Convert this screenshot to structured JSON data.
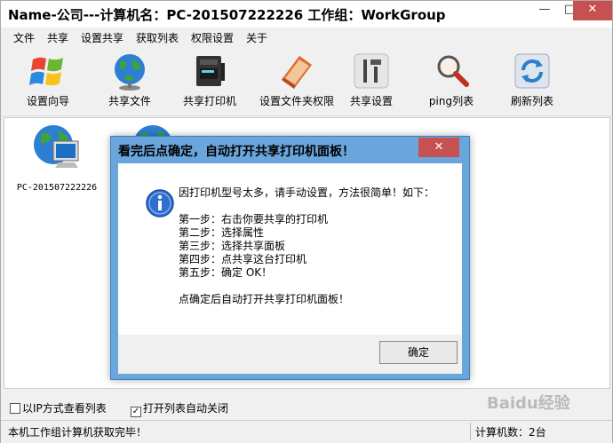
{
  "window": {
    "title": "Name-公司---计算机名：PC-201507222226  工作组：WorkGroup",
    "min_glyph": "—",
    "max_glyph": "□",
    "close_glyph": "✕"
  },
  "menu": {
    "items": [
      "文件",
      "共享",
      "设置共享",
      "获取列表",
      "权限设置",
      "关于"
    ]
  },
  "toolbar": {
    "items": [
      {
        "label": "设置向导",
        "icon": "windows-flag-icon"
      },
      {
        "label": "共享文件",
        "icon": "globe-icon"
      },
      {
        "label": "共享打印机",
        "icon": "printer-icon"
      },
      {
        "label": "设置文件夹权限",
        "icon": "folder-book-icon"
      },
      {
        "label": "共享设置",
        "icon": "tools-icon"
      },
      {
        "label": "ping列表",
        "icon": "magnifier-icon"
      },
      {
        "label": "刷新列表",
        "icon": "refresh-icon"
      }
    ]
  },
  "computers": [
    {
      "name": "PC-201507222226"
    }
  ],
  "options": {
    "ip_view_label": "以IP方式查看列表",
    "ip_view_checked": false,
    "auto_close_label": "打开列表自动关闭",
    "auto_close_checked": true
  },
  "status": {
    "left": "本机工作组计算机获取完毕！",
    "right": "计算机数：2台"
  },
  "dialog": {
    "title": "看完后点确定，自动打开共享打印机面板！",
    "close_glyph": "✕",
    "lines": [
      "因打印机型号太多，请手动设置，方法很简单！如下：",
      "",
      "第一步：右击你要共享的打印机",
      "第二步：选择属性",
      "第三步：选择共享面板",
      "第四步：点共享这台打印机",
      "第五步：确定  OK！",
      "",
      "点确定后自动打开共享打印机面板！"
    ],
    "ok_label": "确定"
  },
  "watermark": "Baidu经验"
}
